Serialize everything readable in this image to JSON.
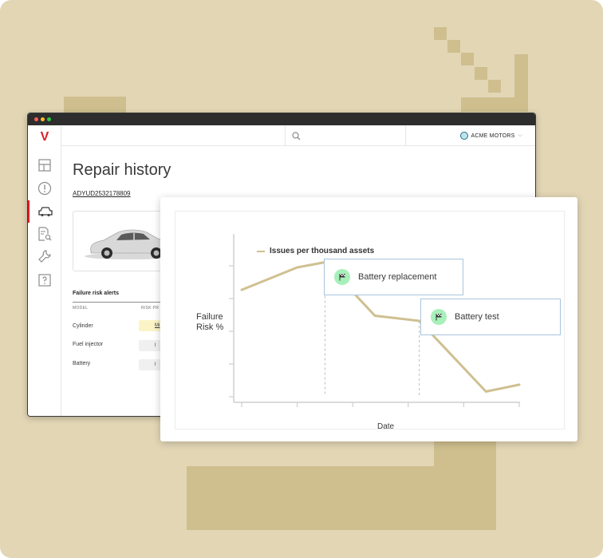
{
  "app": {
    "logo_letter": "V",
    "account_name": "ACME MOTORS",
    "account_chevron": "⌵",
    "sidebar": [
      {
        "icon": "dashboard-icon"
      },
      {
        "icon": "alert-icon"
      },
      {
        "icon": "car-icon",
        "active": true
      },
      {
        "icon": "document-search-icon"
      },
      {
        "icon": "wrench-icon"
      },
      {
        "icon": "help-icon"
      }
    ]
  },
  "page": {
    "title": "Repair history",
    "asset_id": "ADYUD2532178809"
  },
  "alerts": {
    "title": "Failure risk alerts",
    "columns": [
      "Model",
      "Risk pr"
    ],
    "rows": [
      {
        "model": "Cylinder",
        "risk": "Mi",
        "high": true
      },
      {
        "model": "Fuel injector",
        "risk": "l",
        "high": false
      },
      {
        "model": "Battery",
        "risk": "l",
        "high": false
      }
    ]
  },
  "chart_data": {
    "type": "line",
    "series": [
      {
        "name": "Issues per thousand assets",
        "color": "#cfc091",
        "values": [
          62,
          75,
          78,
          47,
          44,
          3,
          7
        ]
      }
    ],
    "x": [
      0.0,
      1.0,
      1.5,
      2.4,
      3.2,
      4.4,
      5.0
    ],
    "ylim": [
      0,
      100
    ],
    "xlim": [
      0,
      5.0
    ],
    "xlabel": "Date",
    "ylabel": "Failure Risk %",
    "legend_position": "top-left",
    "annotations": [
      {
        "label": "Battery replacement",
        "x": 1.5,
        "icon": "flag-icon"
      },
      {
        "label": "Battery test",
        "x": 3.2,
        "icon": "flag-icon"
      }
    ]
  },
  "colors": {
    "backdrop": "#e2d6b5",
    "decor": "#cfbf8f",
    "brand_red": "#da1e28",
    "line": "#cfc091",
    "annotation_border": "#a8c4dd",
    "flag_badge": "#a7f0ba"
  }
}
